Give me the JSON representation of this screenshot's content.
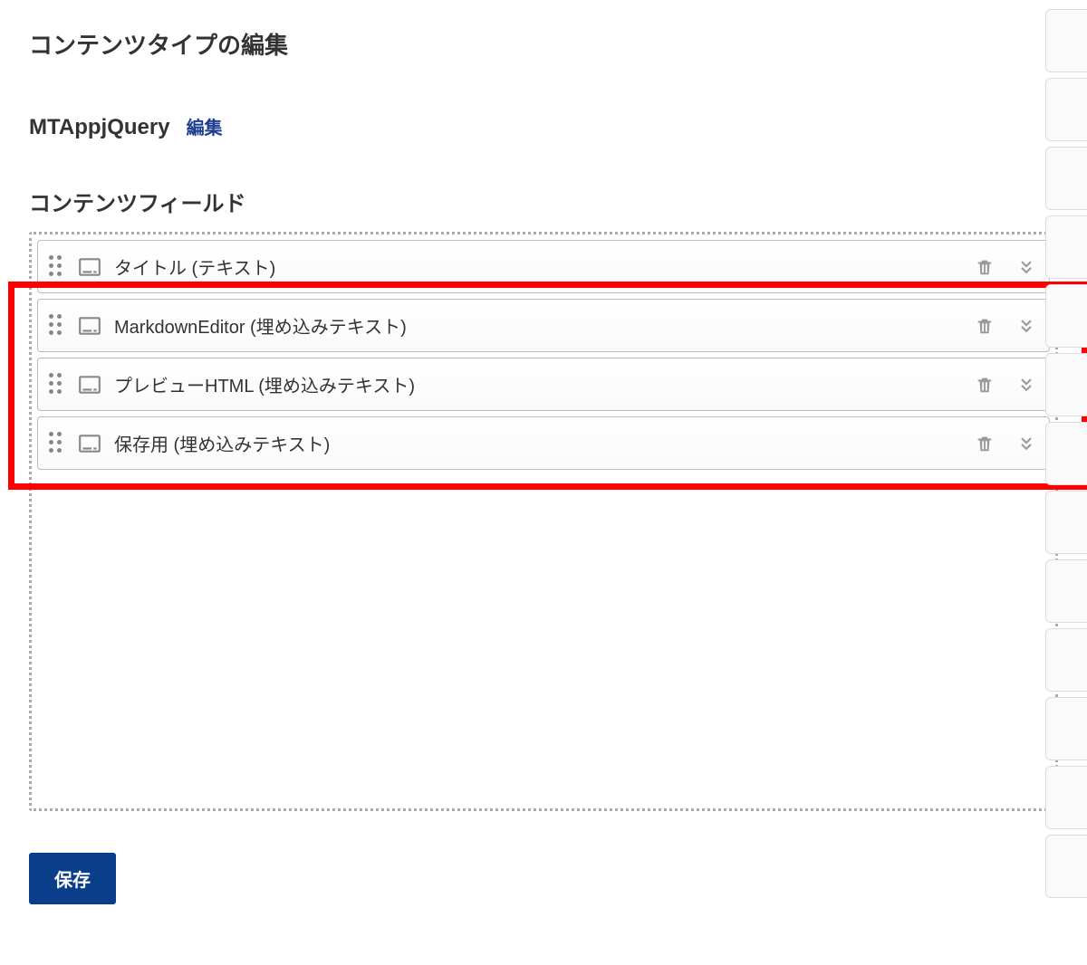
{
  "page": {
    "title": "コンテンツタイプの編集",
    "content_type_name": "MTAppjQuery",
    "edit_link_label": "編集",
    "section_title": "コンテンツフィールド",
    "save_button_label": "保存"
  },
  "fields": [
    {
      "label": "タイトル (テキスト)",
      "icon": "text-field-icon"
    },
    {
      "label": "MarkdownEditor (埋め込みテキスト)",
      "icon": "text-field-icon"
    },
    {
      "label": "プレビューHTML (埋め込みテキスト)",
      "icon": "text-field-icon"
    },
    {
      "label": "保存用 (埋め込みテキスト)",
      "icon": "text-field-icon"
    }
  ],
  "colors": {
    "accent": "#0b3e8a",
    "link": "#1d3f8f",
    "highlight": "#f00"
  }
}
